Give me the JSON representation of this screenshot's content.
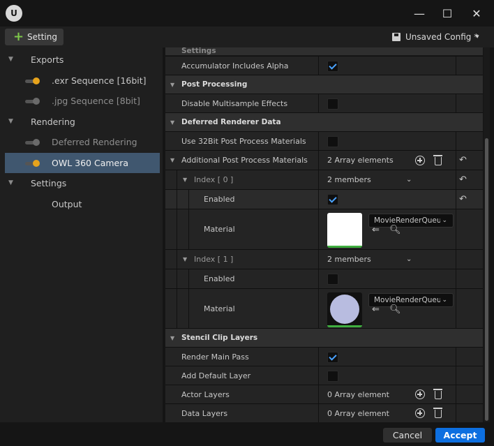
{
  "window": {
    "logo_glyph": "U",
    "controls": {
      "minimize": "—",
      "maximize": "☐",
      "close": "✕"
    }
  },
  "toolbar": {
    "setting_label": "Setting",
    "config_label": "Unsaved Config *",
    "config_caret": "▾"
  },
  "tree": {
    "items": [
      {
        "label": "Exports",
        "level": 0
      },
      {
        "label": ".exr Sequence [16bit]",
        "level": 1,
        "toggle": "on"
      },
      {
        "label": ".jpg Sequence [8bit]",
        "level": 1,
        "toggle": "off"
      },
      {
        "label": "Rendering",
        "level": 0
      },
      {
        "label": "Deferred Rendering",
        "level": 1,
        "toggle": "off"
      },
      {
        "label": "OWL 360 Camera",
        "level": 1,
        "toggle": "on",
        "selected": true
      },
      {
        "label": "Settings",
        "level": 0
      },
      {
        "label": "Output",
        "level": 1
      }
    ]
  },
  "details": {
    "partial_header": "Settings",
    "accumulator_label": "Accumulator Includes Alpha",
    "accumulator_checked": true,
    "post_processing_header": "Post Processing",
    "disable_multisample_label": "Disable Multisample Effects",
    "disable_multisample_checked": false,
    "deferred_header": "Deferred Renderer Data",
    "use32bit_label": "Use 32Bit Post Process Materials",
    "use32bit_checked": false,
    "additional_label": "Additional Post Process Materials",
    "additional_value": "2 Array elements",
    "index0_label": "Index [ 0 ]",
    "index0_value": "2 members",
    "enabled0_label": "Enabled",
    "enabled0_checked": true,
    "material0_label": "Material",
    "material0_value": "MovieRenderQueue",
    "index1_label": "Index [ 1 ]",
    "index1_value": "2 members",
    "enabled1_label": "Enabled",
    "enabled1_checked": false,
    "material1_label": "Material",
    "material1_value": "MovieRenderQueue",
    "stencil_header": "Stencil Clip Layers",
    "render_main_label": "Render Main Pass",
    "render_main_checked": true,
    "add_default_label": "Add Default Layer",
    "add_default_checked": false,
    "actor_layers_label": "Actor Layers",
    "actor_layers_value": "0 Array element",
    "data_layers_label": "Data Layers",
    "data_layers_value": "0 Array element"
  },
  "colors": {
    "accent": "#0d6fe0",
    "selection": "#40576f",
    "toggle_on": "#e6a31c",
    "add_plus": "#7ec84a",
    "thumb0": "#ffffff",
    "thumb1": "#b8bce0"
  },
  "footer": {
    "cancel_label": "Cancel",
    "accept_label": "Accept"
  }
}
